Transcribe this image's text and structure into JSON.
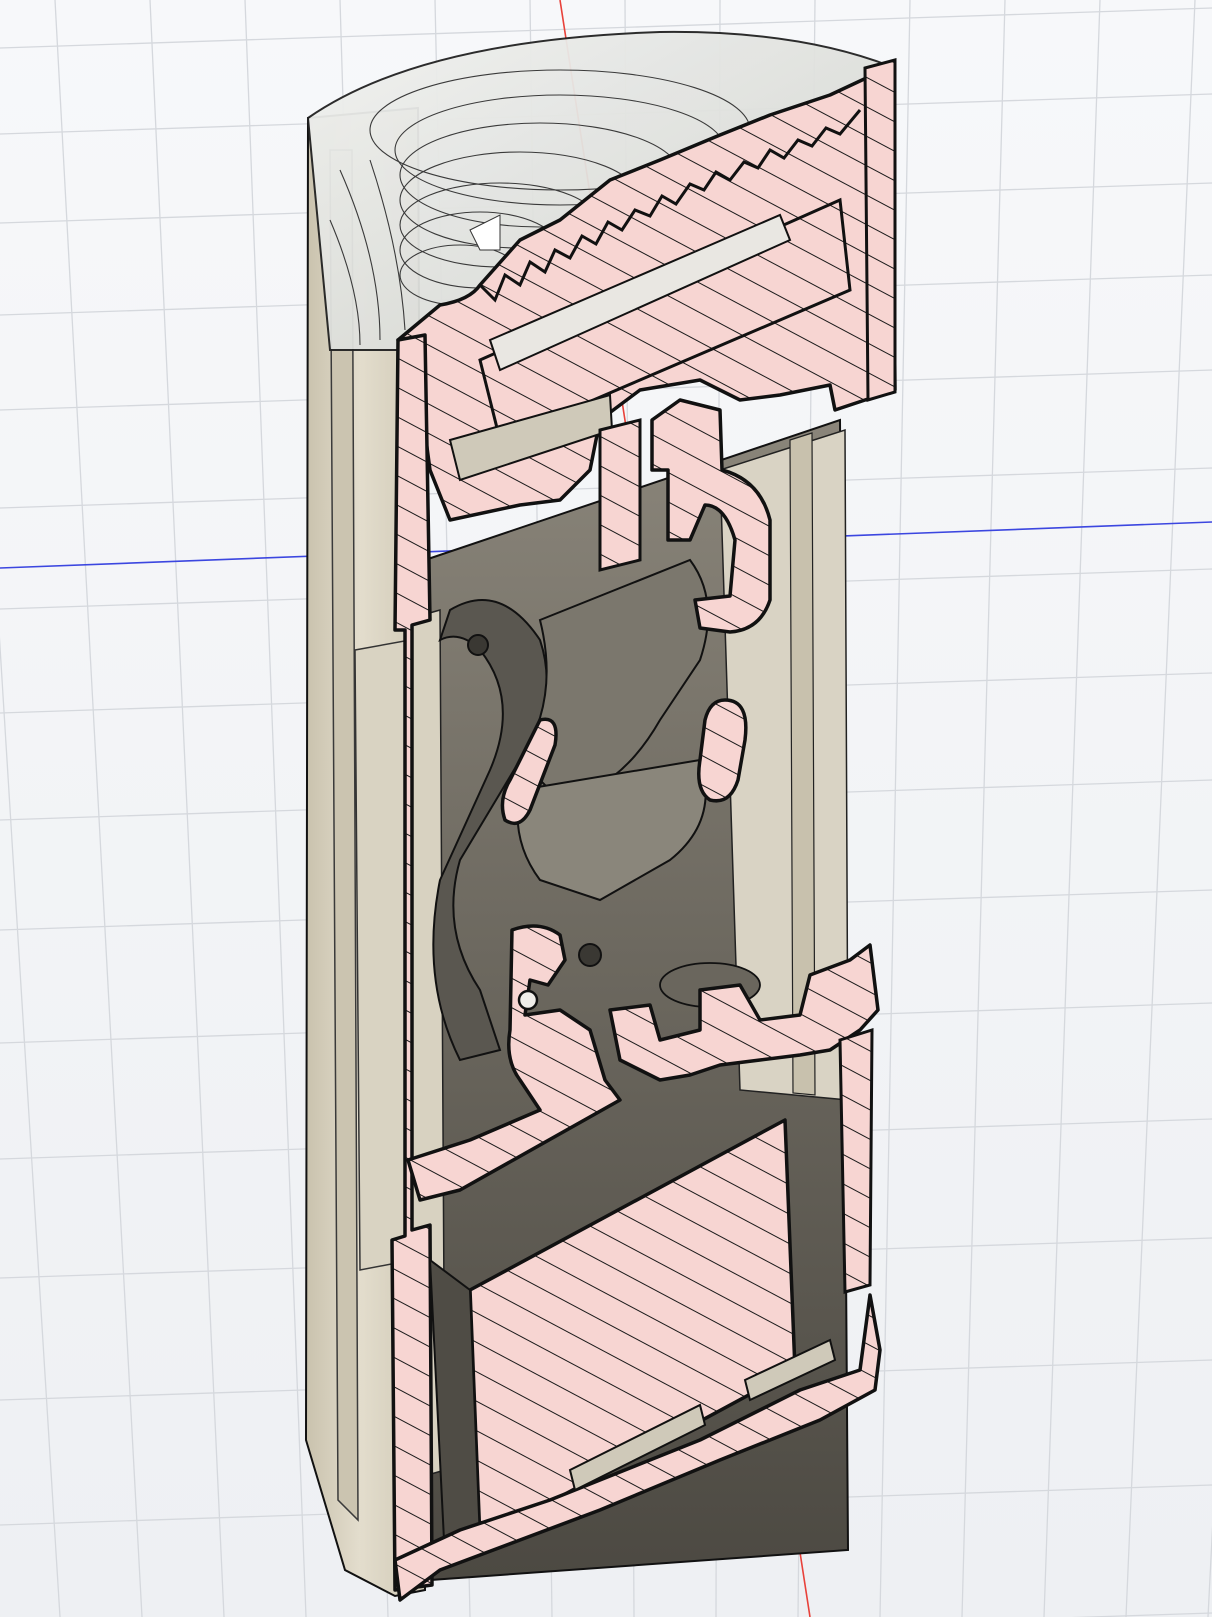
{
  "app": {
    "view": "3d-viewport",
    "mode": "section-analysis"
  },
  "colors": {
    "background": "#f3f4f6",
    "grid_line": "#d5d8dd",
    "axis_x": "#e8413a",
    "axis_y": "#3b46e0",
    "body_outer": "#ded8c8",
    "body_shadow": "#bdb6a3",
    "cavity": "#6f6b62",
    "cavity_dark": "#4a4740",
    "section_fill": "#f7d5d2",
    "hatch": "#1a1a1a",
    "outline": "#111111",
    "glass": "#e9ebea"
  },
  "icons": {
    "grid": "ground-grid",
    "axis_vertical": "x-axis-line",
    "axis_horizontal": "y-axis-line",
    "model": "section-view-model"
  }
}
